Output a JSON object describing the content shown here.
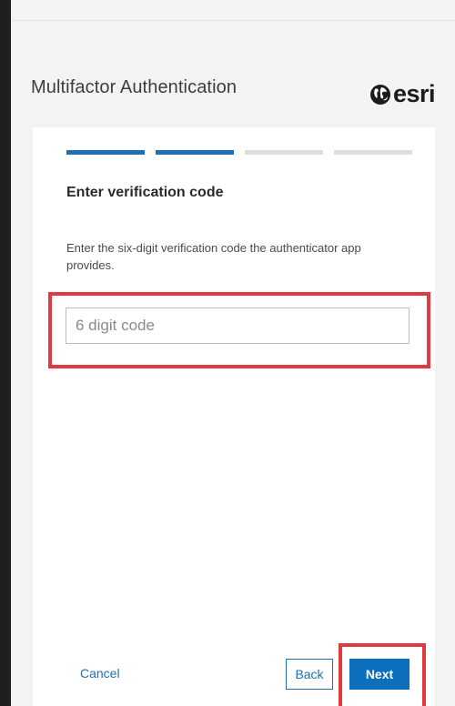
{
  "header": {
    "title": "Multifactor Authentication",
    "logo_text": "esri",
    "logo_icon": "globe-icon"
  },
  "progress": {
    "total_steps": 4,
    "completed_steps": 2,
    "active_color": "#1f6fb2",
    "inactive_color": "#dedede"
  },
  "step": {
    "title": "Enter verification code",
    "description": "Enter the six-digit verification code the authenticator app provides."
  },
  "code_input": {
    "value": "",
    "placeholder": "6 digit code"
  },
  "footer": {
    "cancel_label": "Cancel",
    "back_label": "Back",
    "next_label": "Next"
  },
  "colors": {
    "accent": "#0b6fbe",
    "highlight": "#e03a3e"
  }
}
